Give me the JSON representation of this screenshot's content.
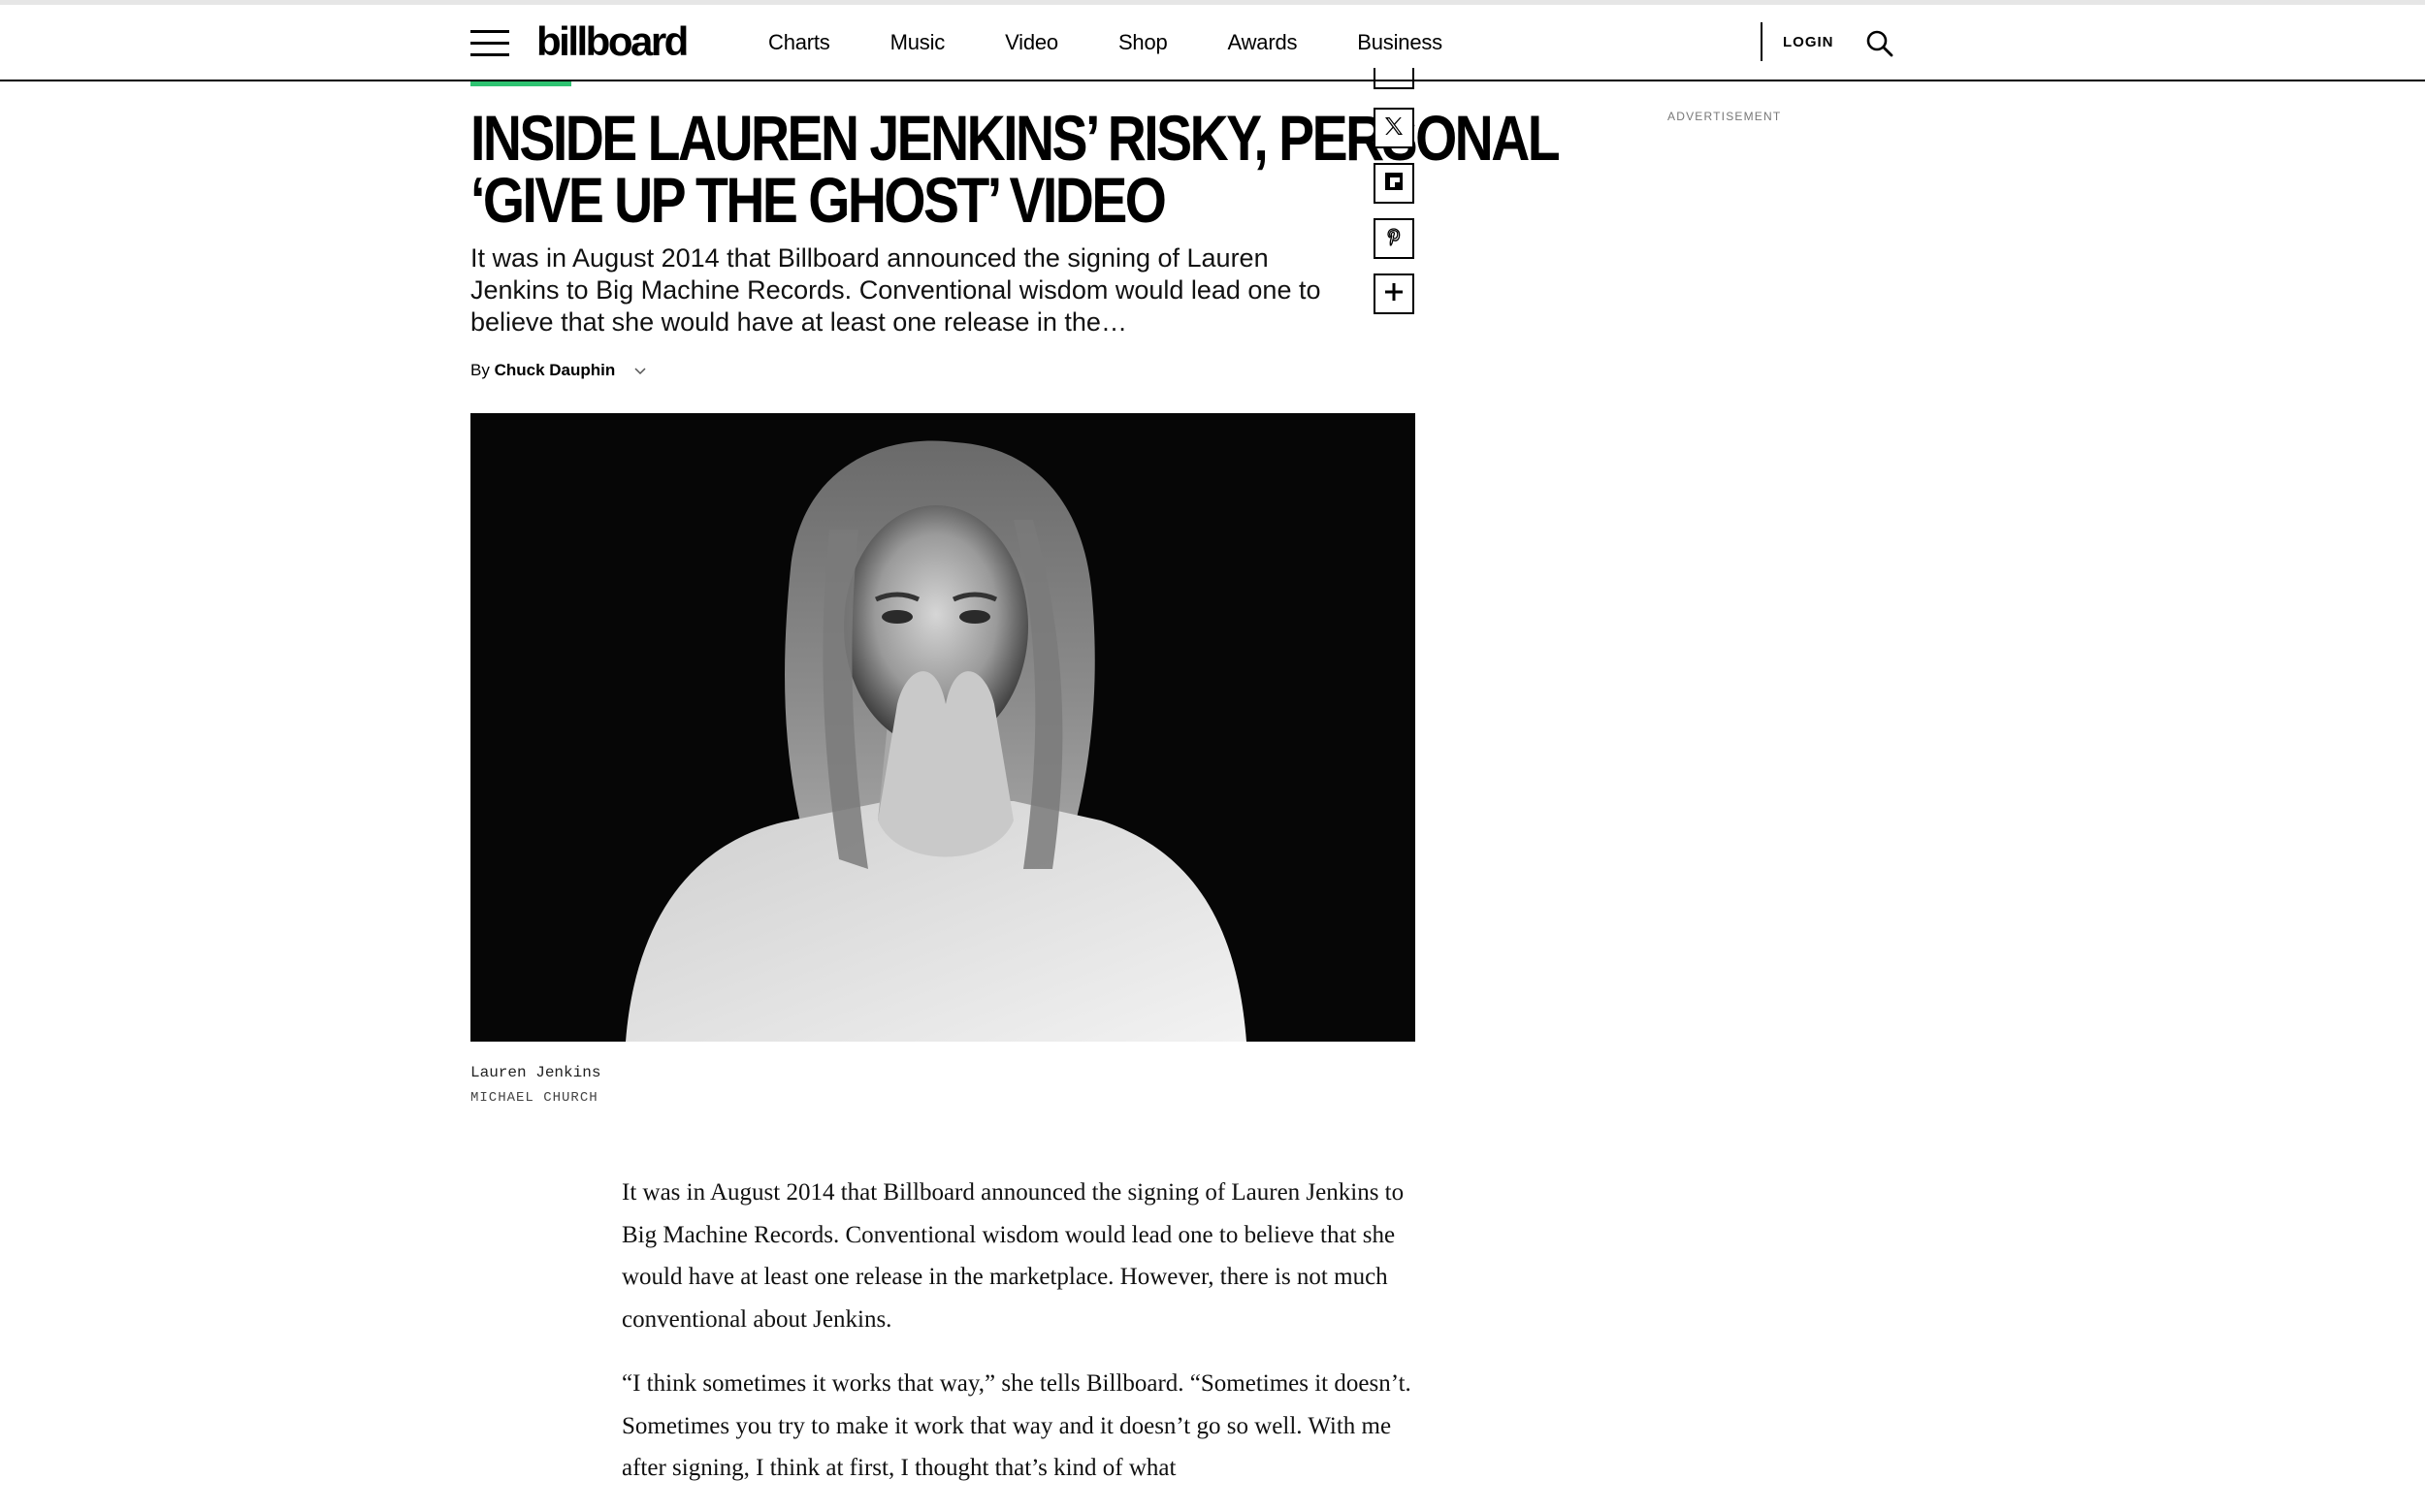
{
  "header": {
    "logo": "billboard",
    "nav": [
      "Charts",
      "Music",
      "Video",
      "Shop",
      "Awards",
      "Business"
    ],
    "login_label": "LOGIN"
  },
  "article": {
    "headline_lines": [
      "INSIDE LAUREN JENKINS’ RISKY, PERSONAL",
      "‘GIVE UP THE GHOST’ VIDEO"
    ],
    "dek": "It was in August 2014 that Billboard announced the signing of Lauren Jenkins to Big Machine Records. Conventional wisdom would lead one to believe that she would have at least one release in the…",
    "byline_prefix": "By",
    "author": "Chuck Dauphin",
    "image_caption": "Lauren Jenkins",
    "image_credit": "MICHAEL CHURCH",
    "paragraphs": [
      "It was in August 2014 that Billboard announced the signing of Lauren Jenkins to Big Machine Records. Conventional wisdom would lead one to believe that she would have at least one release in the marketplace. However, there is not much conventional about Jenkins.",
      "“I think sometimes it works that way,” she tells Billboard. “Sometimes it doesn’t. Sometimes you try to make it work that way and it doesn’t go so well. With me after signing, I think at first, I thought that’s kind of what"
    ]
  },
  "share_icons": [
    "x-icon",
    "flipboard-icon",
    "pinterest-icon",
    "plus-icon"
  ],
  "ad": {
    "label": "ADVERTISEMENT"
  },
  "colors": {
    "accent_green": "#2ec371",
    "text": "#000000"
  }
}
